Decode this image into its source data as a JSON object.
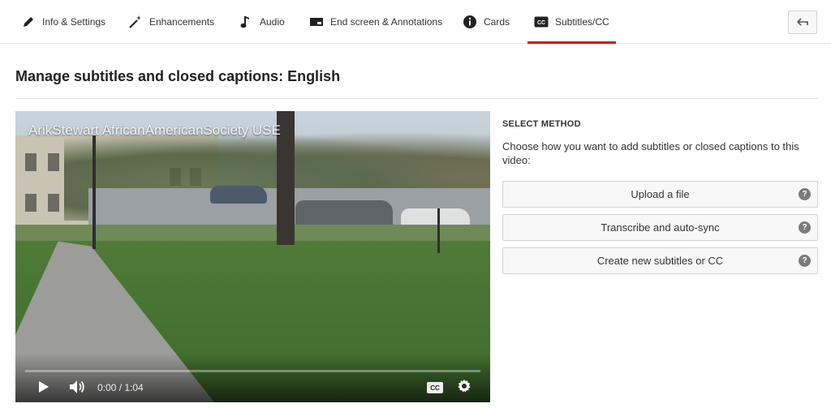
{
  "tabs": [
    {
      "label": "Info & Settings",
      "icon": "pencil-icon"
    },
    {
      "label": "Enhancements",
      "icon": "magic-wand-icon"
    },
    {
      "label": "Audio",
      "icon": "music-note-icon"
    },
    {
      "label": "End screen & Annotations",
      "icon": "end-screen-icon"
    },
    {
      "label": "Cards",
      "icon": "info-icon"
    },
    {
      "label": "Subtitles/CC",
      "icon": "cc-icon",
      "active": true
    }
  ],
  "page": {
    "title": "Manage subtitles and closed captions: English"
  },
  "video": {
    "title": "ArikStewart AfricanAmericanSociety USE",
    "time": "0:00 / 1:04",
    "cc_label": "CC",
    "progress_fraction": 0
  },
  "method": {
    "heading": "SELECT METHOD",
    "description": "Choose how you want to add subtitles or closed captions to this video:",
    "options": [
      {
        "label": "Upload a file"
      },
      {
        "label": "Transcribe and auto-sync"
      },
      {
        "label": "Create new subtitles or CC"
      }
    ],
    "help_glyph": "?"
  },
  "colors": {
    "active_tab_underline": "#cc181e"
  }
}
